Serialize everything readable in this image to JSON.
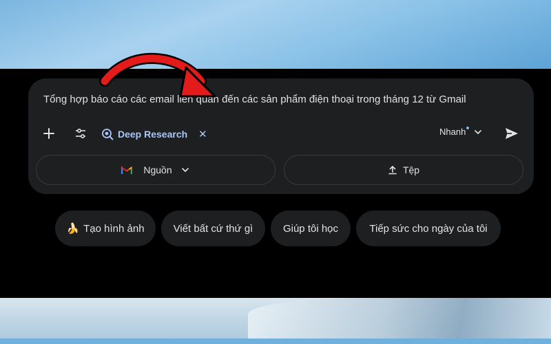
{
  "prompt": {
    "text": "Tổng hợp báo cáo các email liên quan đến các sản phẩm điện thoại trong tháng 12 từ Gmail"
  },
  "toolbar": {
    "add_icon": "plus-icon",
    "tools_icon": "tune-icon",
    "deep_research_label": "Deep Research",
    "deep_research_icon": "deep-research-icon",
    "close_glyph": "✕",
    "model_label": "Nhanh",
    "send_icon": "send-icon"
  },
  "actions": {
    "sources_label": "Nguồn",
    "sources_icon": "gmail-icon",
    "files_label": "Tệp",
    "files_icon": "upload-icon"
  },
  "suggestions": [
    {
      "label": "Tạo hình ảnh",
      "emoji": "🍌"
    },
    {
      "label": "Viết bất cứ thứ gì"
    },
    {
      "label": "Giúp tôi học"
    },
    {
      "label": "Tiếp sức cho ngày của tôi"
    }
  ],
  "colors": {
    "background": "#000000",
    "composer": "#1e1f21",
    "accent": "#a8c7fa",
    "arrow": "#e31b1b"
  }
}
